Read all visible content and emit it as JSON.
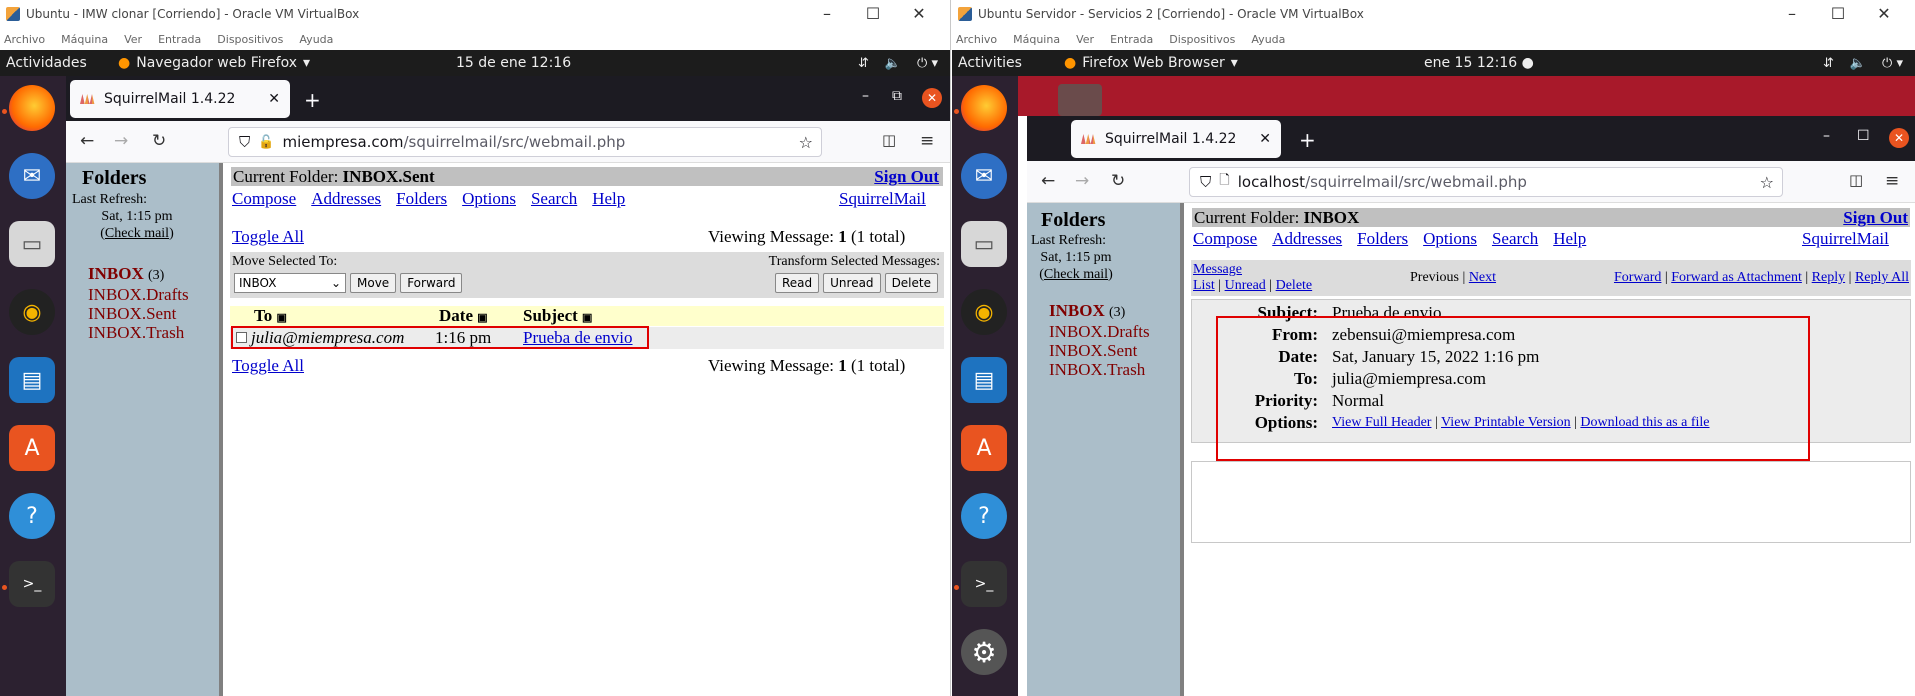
{
  "left_vm": {
    "title": "Ubuntu - IMW clonar [Corriendo] - Oracle VM VirtualBox",
    "menu": [
      "Archivo",
      "Máquina",
      "Ver",
      "Entrada",
      "Dispositivos",
      "Ayuda"
    ],
    "topbar": {
      "activities": "Actividades",
      "app": "Navegador web Firefox",
      "clock": "15 de ene  12:16"
    },
    "tab_title": "SquirrelMail 1.4.22",
    "url_host": "miempresa.com",
    "url_path": "/squirrelmail/src/webmail.php",
    "sidebar": {
      "title": "Folders",
      "refresh_label": "Last Refresh:",
      "refresh_time": "Sat, 1:15 pm",
      "check_mail": "Check mail",
      "folders": [
        {
          "name": "INBOX",
          "count": "(3)"
        },
        {
          "name": "INBOX.Drafts"
        },
        {
          "name": "INBOX.Sent"
        },
        {
          "name": "INBOX.Trash"
        }
      ]
    },
    "current_folder_label": "Current Folder:",
    "current_folder": "INBOX.Sent",
    "sign_out": "Sign Out",
    "menu_links": [
      "Compose",
      "Addresses",
      "Folders",
      "Options",
      "Search",
      "Help"
    ],
    "brand": "SquirrelMail",
    "toggle_all": "Toggle All",
    "viewing_prefix": "Viewing Message:",
    "viewing_num": "1",
    "viewing_total": "(1 total)",
    "move_selected": "Move Selected To:",
    "transform": "Transform Selected Messages:",
    "folder_select": "INBOX",
    "buttons": {
      "move": "Move",
      "forward": "Forward",
      "read": "Read",
      "unread": "Unread",
      "delete": "Delete"
    },
    "columns": {
      "to": "To",
      "date": "Date",
      "subject": "Subject"
    },
    "message": {
      "to": "julia@miempresa.com",
      "date": "1:16 pm",
      "subject": "Prueba de envio"
    }
  },
  "right_vm": {
    "title": "Ubuntu Servidor - Servicios 2 [Corriendo] - Oracle VM VirtualBox",
    "menu": [
      "Archivo",
      "Máquina",
      "Ver",
      "Entrada",
      "Dispositivos",
      "Ayuda"
    ],
    "topbar": {
      "activities": "Activities",
      "app": "Firefox Web Browser",
      "clock": "ene 15  12:16"
    },
    "tab_title": "SquirrelMail 1.4.22",
    "url_host": "localhost",
    "url_path": "/squirrelmail/src/webmail.php",
    "sidebar": {
      "title": "Folders",
      "refresh_label": "Last Refresh:",
      "refresh_time": "Sat, 1:15 pm",
      "check_mail": "Check mail",
      "folders": [
        {
          "name": "INBOX",
          "count": "(3)"
        },
        {
          "name": "INBOX.Drafts"
        },
        {
          "name": "INBOX.Sent"
        },
        {
          "name": "INBOX.Trash"
        }
      ]
    },
    "current_folder_label": "Current Folder:",
    "current_folder": "INBOX",
    "sign_out": "Sign Out",
    "menu_links": [
      "Compose",
      "Addresses",
      "Folders",
      "Options",
      "Search",
      "Help"
    ],
    "brand": "SquirrelMail",
    "msg_nav": {
      "message": "Message",
      "list": "List",
      "unread": "Unread",
      "delete": "Delete",
      "previous": "Previous",
      "next": "Next",
      "forward": "Forward",
      "forward_attach": "Forward as Attachment",
      "reply": "Reply",
      "reply_all": "Reply All"
    },
    "headers": {
      "subject_label": "Subject:",
      "subject": "Prueba de envio",
      "from_label": "From:",
      "from": "zebensui@miempresa.com",
      "date_label": "Date:",
      "date": "Sat, January 15, 2022 1:16 pm",
      "to_label": "To:",
      "to": "julia@miempresa.com",
      "priority_label": "Priority:",
      "priority": "Normal",
      "options_label": "Options:",
      "opt_full_header": "View Full Header",
      "opt_printable": "View Printable Version",
      "opt_download": "Download this as a file"
    }
  }
}
